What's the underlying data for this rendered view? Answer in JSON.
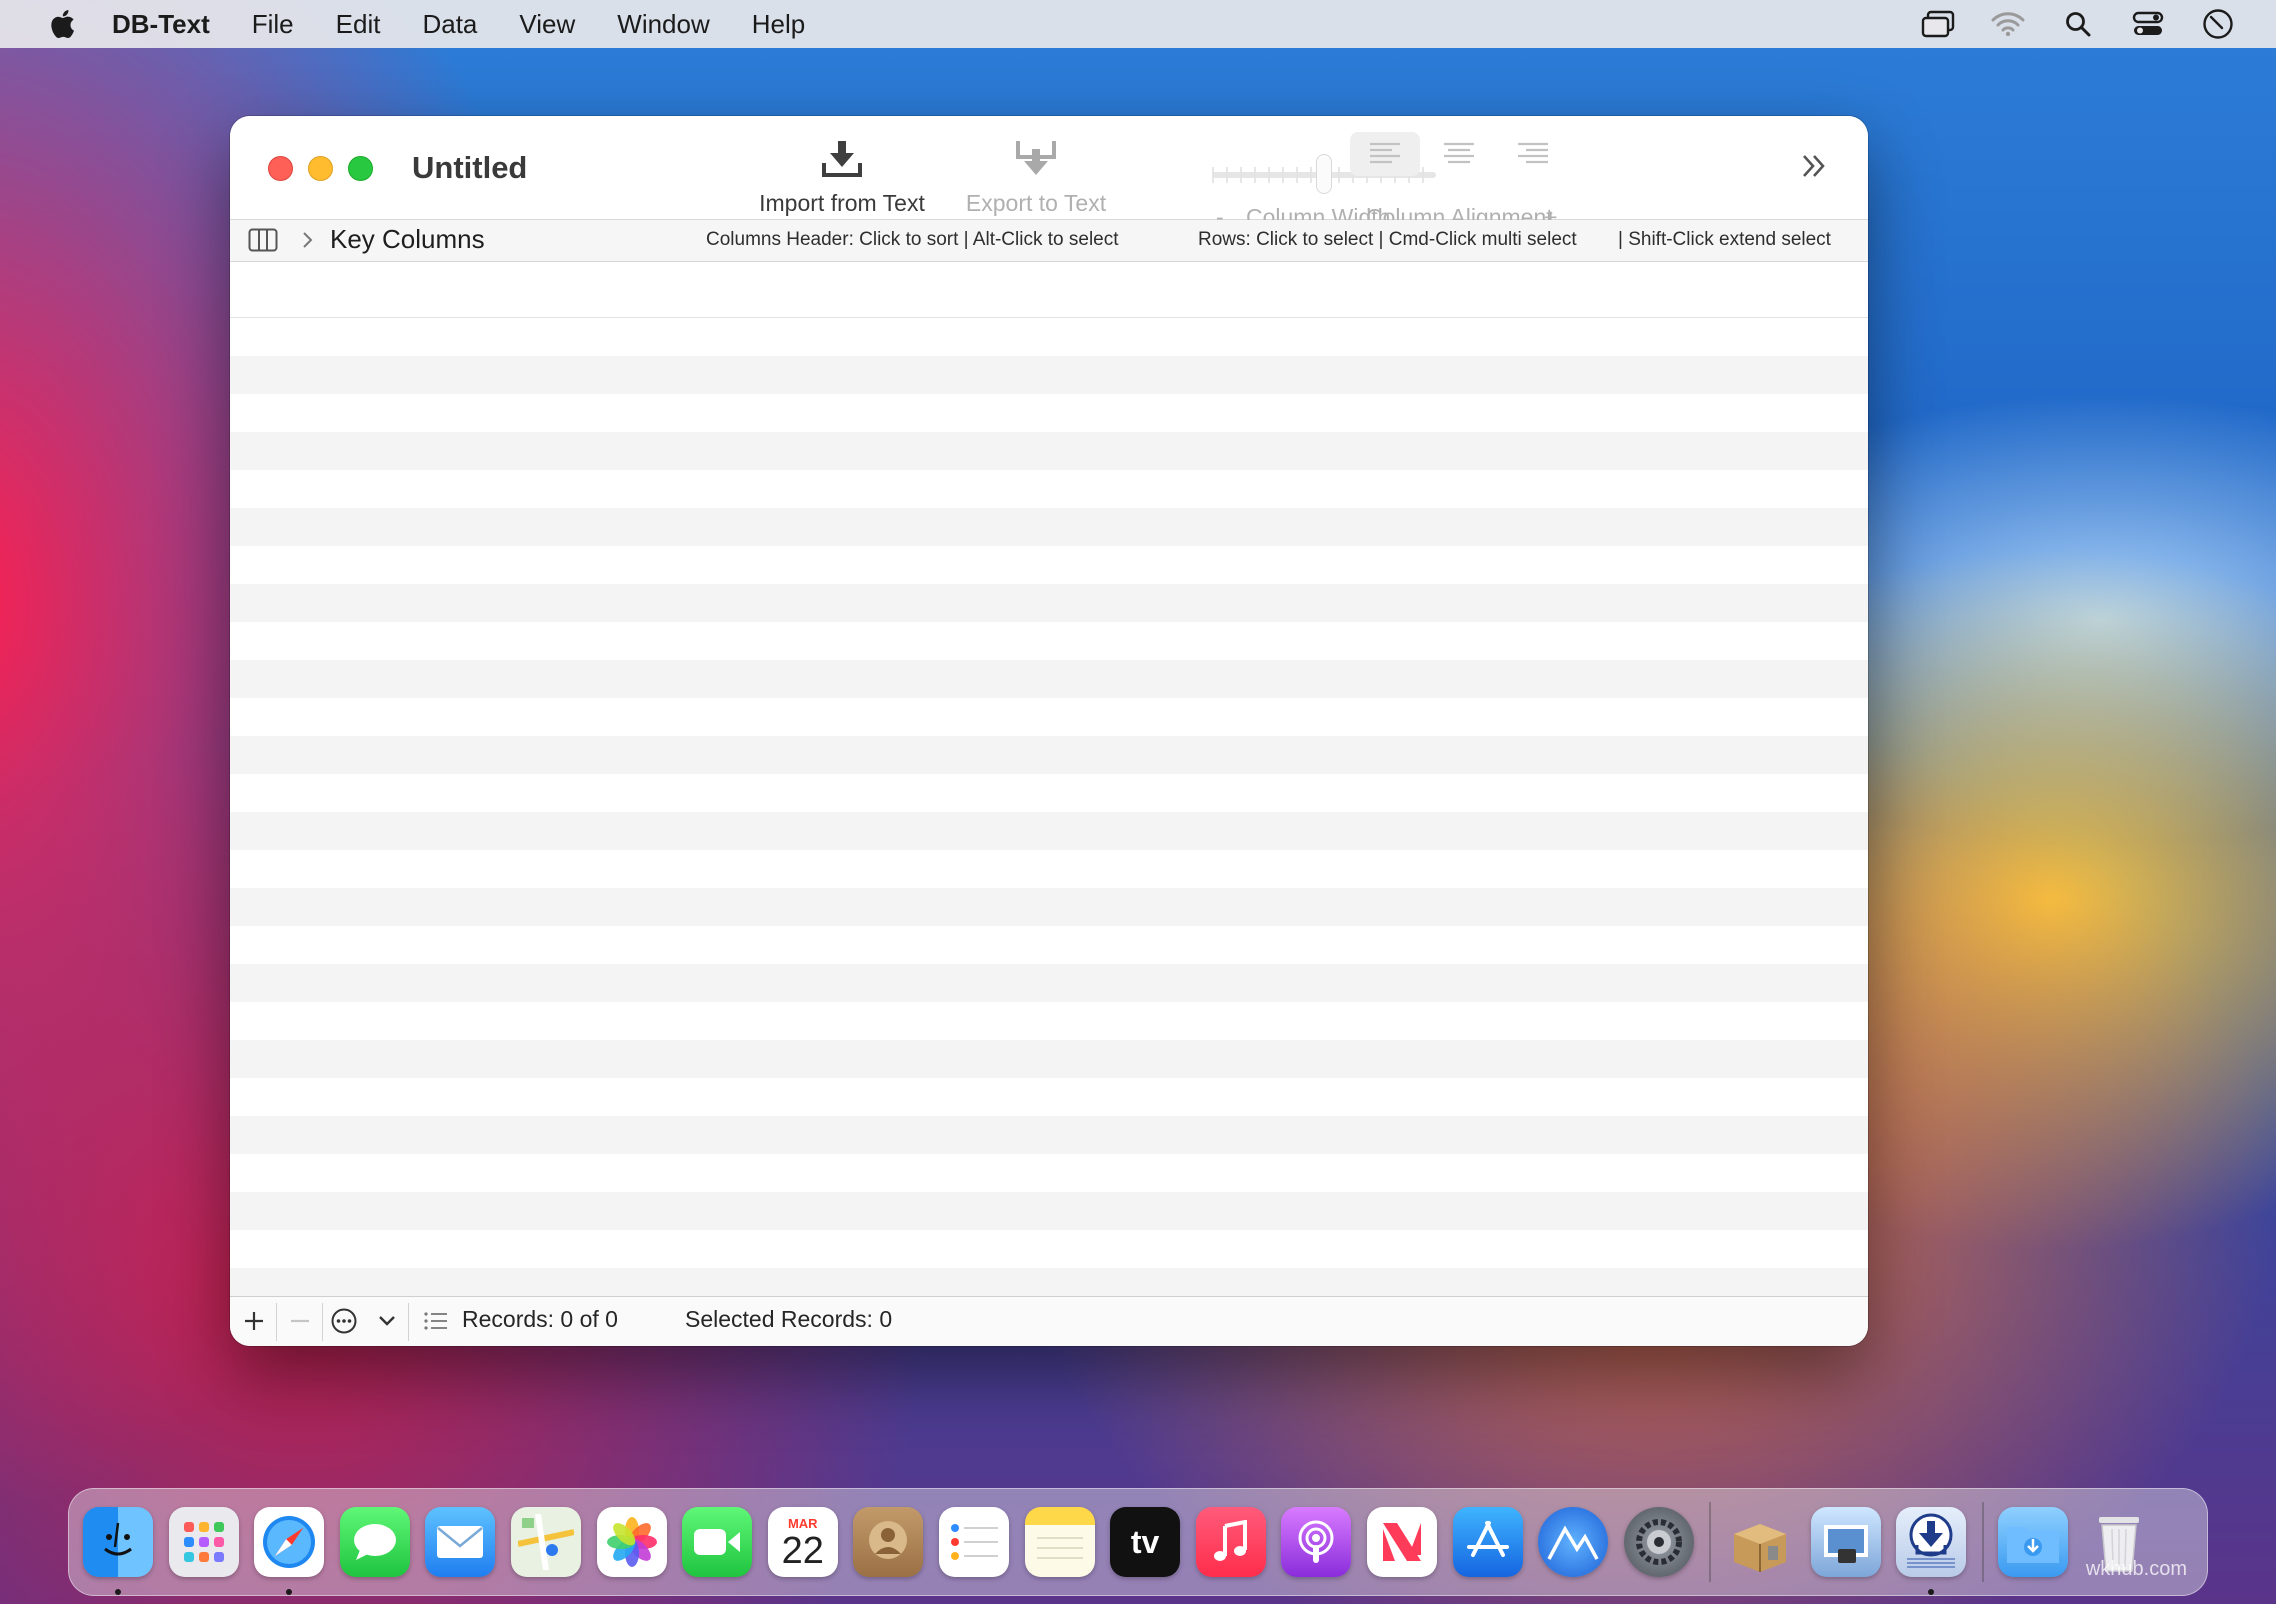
{
  "menubar": {
    "apple_icon": "apple-logo-icon",
    "items": [
      {
        "label": "DB-Text"
      },
      {
        "label": "File"
      },
      {
        "label": "Edit"
      },
      {
        "label": "Data"
      },
      {
        "label": "View"
      },
      {
        "label": "Window"
      },
      {
        "label": "Help"
      }
    ],
    "status_icons": [
      "screen-mirroring-icon",
      "wifi-icon",
      "spotlight-search-icon",
      "control-center-icon",
      "screen-time-icon"
    ]
  },
  "window": {
    "title": "Untitled",
    "toolbar": {
      "import_label": "Import from Text",
      "export_label": "Export to Text",
      "width_minus": "-",
      "width_label": "Column Width",
      "width_plus": "+",
      "alignment_label": "Column Alignment"
    },
    "keybar": {
      "title": "Key Columns",
      "hint_header": "Columns Header: Click to sort | Alt-Click to select",
      "hint_rows": "Rows: Click to select | Cmd-Click multi select",
      "hint_shift": "| Shift-Click extend select"
    },
    "statusbar": {
      "records": "Records: 0 of 0",
      "selected": "Selected Records: 0"
    }
  },
  "dock": {
    "calendar_month": "MAR",
    "calendar_day": "22",
    "tv_label": "tv",
    "watermark": "wkhub.com"
  },
  "colors": {
    "close": "#fe5f57",
    "minimize": "#febc2e",
    "maximize": "#28c840"
  }
}
